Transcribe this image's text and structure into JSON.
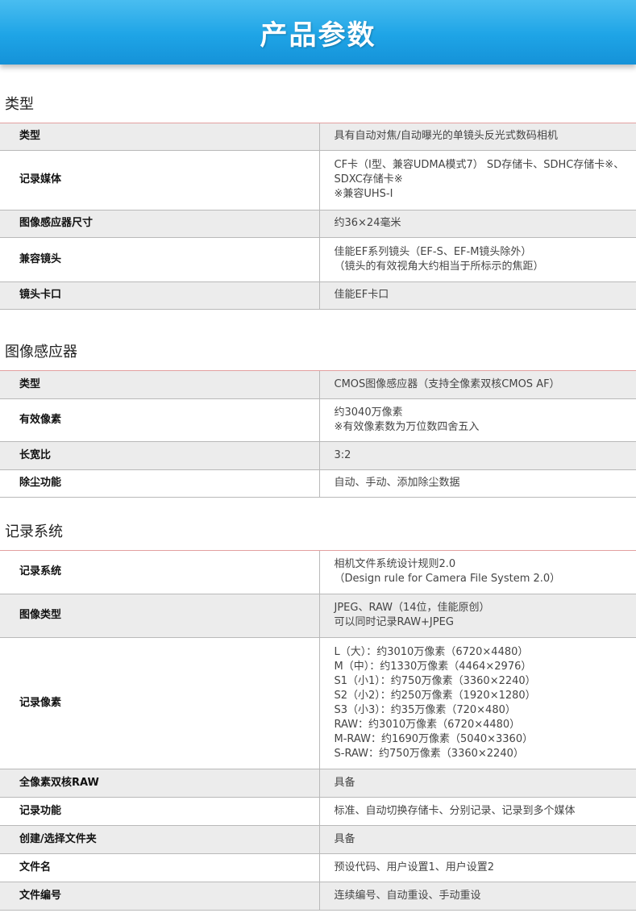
{
  "banner": {
    "title": "产品参数"
  },
  "sections": [
    {
      "title": "类型",
      "rows": [
        {
          "key": "类型",
          "lines": [
            "具有自动对焦/自动曝光的单镜头反光式数码相机"
          ]
        },
        {
          "key": "记录媒体",
          "lines": [
            "CF卡（I型、兼容UDMA模式7） SD存储卡、SDHC存储卡※、",
            "SDXC存储卡※",
            "※兼容UHS-I"
          ]
        },
        {
          "key": "图像感应器尺寸",
          "lines": [
            "约36×24毫米"
          ]
        },
        {
          "key": "兼容镜头",
          "lines": [
            "佳能EF系列镜头（EF-S、EF-M镜头除外）",
            "（镜头的有效视角大约相当于所标示的焦距）"
          ]
        },
        {
          "key": "镜头卡口",
          "lines": [
            "佳能EF卡口"
          ]
        }
      ]
    },
    {
      "title": "图像感应器",
      "rows": [
        {
          "key": "类型",
          "lines": [
            "CMOS图像感应器（支持全像素双核CMOS AF）"
          ]
        },
        {
          "key": "有效像素",
          "lines": [
            "约3040万像素",
            "※有效像素数为万位数四舍五入"
          ]
        },
        {
          "key": "长宽比",
          "lines": [
            "3:2"
          ]
        },
        {
          "key": "除尘功能",
          "lines": [
            "自动、手动、添加除尘数据"
          ]
        }
      ]
    },
    {
      "title": "记录系统",
      "rows": [
        {
          "key": "记录系统",
          "lines": [
            "相机文件系统设计规则2.0",
            "（Design rule for Camera File System 2.0）"
          ]
        },
        {
          "key": "图像类型",
          "lines": [
            "JPEG、RAW（14位，佳能原创）",
            "可以同时记录RAW+JPEG"
          ]
        },
        {
          "key": "记录像素",
          "lines": [
            "L（大）：约3010万像素（6720×4480）",
            "M（中）：约1330万像素（4464×2976）",
            "S1（小1）：约750万像素（3360×2240）",
            "S2（小2）：约250万像素（1920×1280）",
            "S3（小3）：约35万像素（720×480）",
            "RAW：约3010万像素（6720×4480）",
            "M-RAW：约1690万像素（5040×3360）",
            "S-RAW：约750万像素（3360×2240）"
          ]
        },
        {
          "key": "全像素双核RAW",
          "lines": [
            "具备"
          ]
        },
        {
          "key": "记录功能",
          "lines": [
            "标准、自动切换存储卡、分别记录、记录到多个媒体"
          ]
        },
        {
          "key": "创建/选择文件夹",
          "lines": [
            "具备"
          ]
        },
        {
          "key": "文件名",
          "lines": [
            "预设代码、用户设置1、用户设置2"
          ]
        },
        {
          "key": "文件编号",
          "lines": [
            "连续编号、自动重设、手动重设"
          ]
        }
      ]
    }
  ]
}
